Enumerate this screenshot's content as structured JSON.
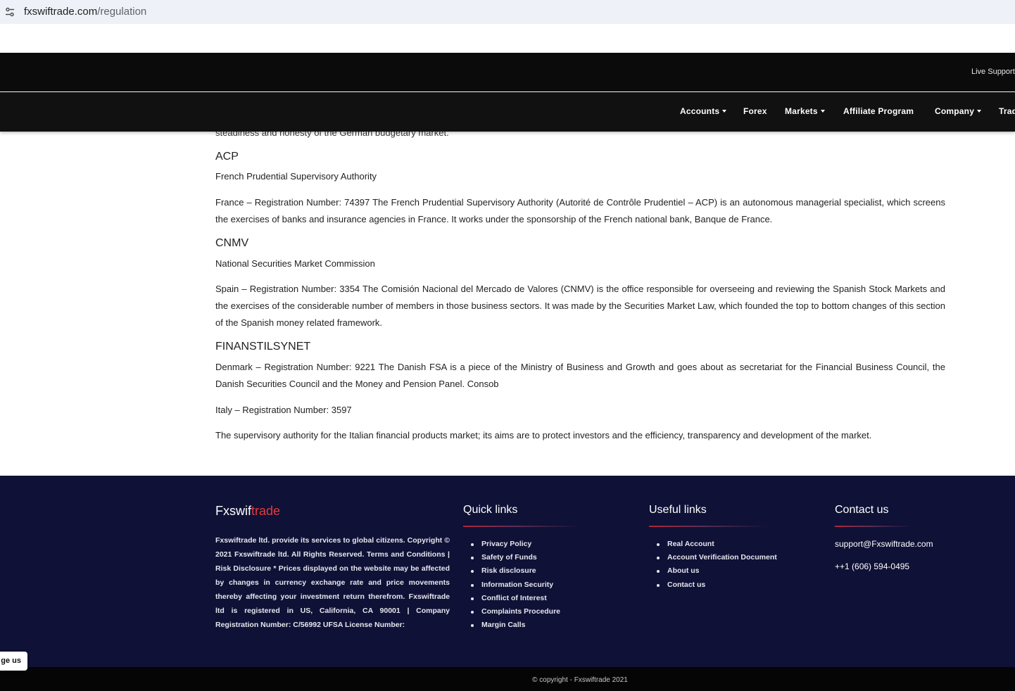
{
  "browser": {
    "url_domain": "fxswiftrade.com",
    "url_path": "/regulation",
    "site_info_icon": "tune-icon"
  },
  "header": {
    "live_support": "Live Support",
    "nav": [
      {
        "label": "Accounts",
        "dropdown": true
      },
      {
        "label": "Forex",
        "dropdown": false
      },
      {
        "label": "Markets",
        "dropdown": true
      },
      {
        "label": "Affiliate Program",
        "dropdown": false
      },
      {
        "label": "Company",
        "dropdown": true
      },
      {
        "label": "Trad",
        "dropdown": false
      }
    ]
  },
  "content": {
    "cut_text": "steadiness and honesty of the German budgetary market.",
    "acp": {
      "heading": "ACP",
      "subtitle": "French Prudential Supervisory Authority",
      "body": "France – Registration Number: 74397 The French Prudential Supervisory Authority (Autorité de Contrôle Prudentiel – ACP) is an autonomous managerial specialist, which screens the exercises of banks and insurance agencies in France. It works under the sponsorship of the French national bank, Banque de France."
    },
    "cnmv": {
      "heading": "CNMV",
      "subtitle": "National Securities Market Commission",
      "body": "Spain – Registration Number: 3354 The Comisión Nacional del Mercado de Valores (CNMV) is the office responsible for overseeing and reviewing the Spanish Stock Markets and the exercises of the considerable number of members in those business sectors. It was made by the Securities Market Law, which founded the top to bottom changes of this section of the Spanish money related framework."
    },
    "finanstilsynet": {
      "heading": "FINANSTILSYNET",
      "body": "Denmark – Registration Number: 9221 The Danish FSA is a piece of the Ministry of Business and Growth and goes about as secretariat for the Financial Business Council, the Danish Securities Council and the Money and Pension Panel. Consob",
      "italy": "Italy – Registration Number: 3597",
      "supervisory": "The supervisory authority for the Italian financial products market; its aims are to protect investors and the efficiency, transparency and development of the market."
    }
  },
  "footer": {
    "brand_part1": "Fxswif",
    "brand_part2": "trade",
    "about": "Fxswiftrade ltd. provide its services to global citizens. Copyright © 2021 Fxswiftrade ltd. All Rights Reserved. Terms and Conditions | Risk Disclosure * Prices displayed on the website may be affected by changes in currency exchange rate and price movements thereby affecting your investment return therefrom. Fxswiftrade ltd is registered in US, California, CA 90001 | Company Registration Number: C/56992 UFSA License Number:",
    "quick_links": {
      "title": "Quick links",
      "items": [
        "Privacy Policy",
        "Safety of Funds",
        "Risk disclosure",
        "Information Security",
        "Conflict of Interest",
        "Complaints Procedure",
        "Margin Calls"
      ]
    },
    "useful_links": {
      "title": "Useful links",
      "items": [
        "Real Account",
        "Account Verification Document",
        "About us",
        "Contact us"
      ]
    },
    "contact": {
      "title": "Contact us",
      "email": "support@Fxswiftrade.com",
      "phone": "++1 (606) 594-0495"
    },
    "copyright": "© copyright - Fxswiftrade 2021",
    "chat_tab": "ge us"
  },
  "colors": {
    "footer_bg": "#0f1136",
    "brand_accent": "#e63a3a",
    "nav_bg": "#111111"
  }
}
